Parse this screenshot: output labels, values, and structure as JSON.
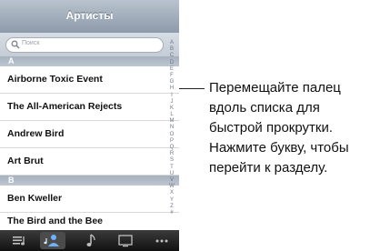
{
  "navbar": {
    "title": "Артисты"
  },
  "search": {
    "placeholder": "Поиск"
  },
  "sections": [
    {
      "header": "A",
      "rows": [
        "Airborne Toxic Event",
        "The All-American Rejects",
        "Andrew Bird",
        "Art Brut"
      ]
    },
    {
      "header": "B",
      "rows": [
        "Ben Kweller",
        "The Bird and the Bee"
      ]
    }
  ],
  "index_letters": [
    "A",
    "B",
    "C",
    "D",
    "E",
    "F",
    "G",
    "H",
    "I",
    "J",
    "K",
    "L",
    "M",
    "N",
    "O",
    "P",
    "Q",
    "R",
    "S",
    "T",
    "U",
    "V",
    "W",
    "X",
    "Y",
    "Z",
    "#"
  ],
  "tabbar": {
    "tabs": [
      "playlists-icon",
      "artists-icon",
      "songs-icon",
      "videos-icon",
      "more-icon"
    ],
    "selected": 1
  },
  "callout": {
    "lines": [
      "Перемещайте палец",
      "вдоль списка для",
      "быстрой прокрутки.",
      "Нажмите букву, чтобы",
      "перейти к разделу."
    ]
  },
  "colors": {
    "navbar": "#9ba7b6",
    "section_header": "#b3bdc8",
    "tabbar": "#1c1c1c",
    "selected_tab_icon": "#6fb1ff"
  }
}
